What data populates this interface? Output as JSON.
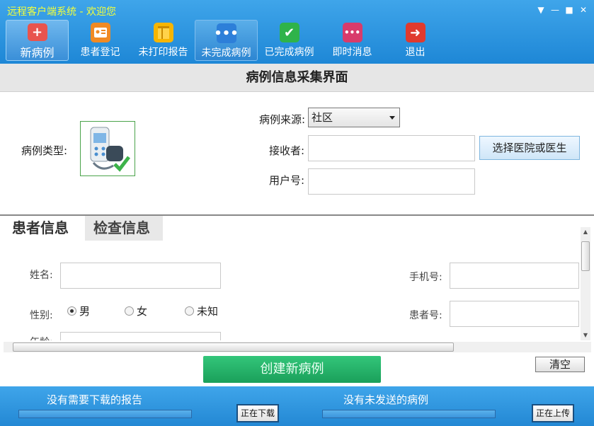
{
  "window": {
    "title": "远程客户端系统 - 欢迎您",
    "controls": [
      "▼",
      "—",
      "■",
      "✕"
    ]
  },
  "toolbar": {
    "items": [
      {
        "label": "新病例",
        "icon": "plus-icon",
        "color": "#e8544e"
      },
      {
        "label": "患者登记",
        "icon": "id-card-icon",
        "color": "#f08a24"
      },
      {
        "label": "未打印报告",
        "icon": "notebook-icon",
        "color": "#f7b500"
      },
      {
        "label": "未完成病例",
        "icon": "ellipsis-icon",
        "color": "#2d7fd9"
      },
      {
        "label": "已完成病例",
        "icon": "check-icon",
        "color": "#2fb34a"
      },
      {
        "label": "即时消息",
        "icon": "chat-icon",
        "color": "#d83b6b"
      },
      {
        "label": "退出",
        "icon": "exit-icon",
        "color": "#e03a2e"
      }
    ]
  },
  "header": {
    "title": "病例信息采集界面"
  },
  "case_info": {
    "case_type_label": "病例类型:",
    "device_icon": "blood-pressure-monitor-icon",
    "source_label": "病例来源:",
    "source_value": "社区",
    "receiver_label": "接收者:",
    "receiver_value": "",
    "user_id_label": "用户号:",
    "user_id_value": "",
    "select_button": "选择医院或医生"
  },
  "tabs": [
    {
      "label": "患者信息"
    },
    {
      "label": "检查信息"
    }
  ],
  "patient_form": {
    "name_label": "姓名:",
    "name_value": "",
    "phone_label": "手机号:",
    "phone_value": "",
    "gender_label": "性别:",
    "gender_options": [
      "男",
      "女",
      "未知"
    ],
    "gender_selected": "男",
    "patient_no_label": "患者号:",
    "patient_no_value": "",
    "age_label": "年龄:"
  },
  "actions": {
    "create_label": "创建新病例",
    "clear_label": "清空"
  },
  "status": {
    "download_text": "没有需要下载的报告",
    "download_button": "正在下载",
    "upload_text": "没有未发送的病例",
    "upload_button": "正在上传"
  }
}
